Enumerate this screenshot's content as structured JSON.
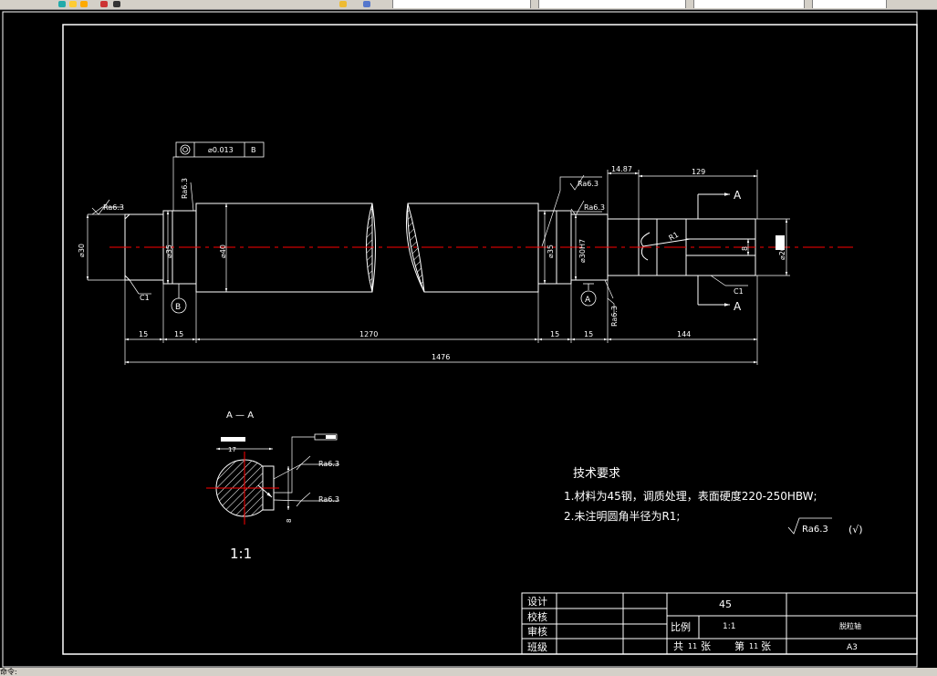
{
  "toolbar": {
    "tab_1": "",
    "tab_2": "",
    "tab_3": "",
    "combo_right": ""
  },
  "dims": {
    "d15a": "15",
    "d15b": "15",
    "d1270": "1270",
    "d15c": "15",
    "d15d": "15",
    "d144": "144",
    "d1476": "1476",
    "d1487": "14.87",
    "d129": "129",
    "dia30": "⌀30",
    "dia35a": "⌀35",
    "dia40": "⌀40",
    "dia35b": "⌀35",
    "dia30h7": "⌀30H7",
    "dia26": "⌀26",
    "d8": "8",
    "r1": "R1"
  },
  "labels": {
    "c1_left": "C1",
    "c1_right": "C1",
    "ra_left": "Ra6.3",
    "ra_top_left": "Ra6.3",
    "ra_top_right": "Ra6.3",
    "ra_mid_right": "Ra6.3",
    "ra_bottom_right": "Ra6.3",
    "datum_b": "B",
    "datum_a": "A",
    "section_a_top": "A",
    "section_a_bottom": "A",
    "gdt_tolerance": "⌀0.013",
    "gdt_datum": "B"
  },
  "section": {
    "title": "A — A",
    "scale": "1:1",
    "ra_top": "Ra6.3",
    "ra_bottom": "Ra6.3",
    "dim_top": "17",
    "dim_side": "8"
  },
  "notes": {
    "heading": "技术要求",
    "line1": "1.材料为45钢，调质处理，表面硬度220-250HBW;",
    "line2": "2.未注明圆角半径为R1;",
    "general_ra": "Ra6.3",
    "general_mark": "(√)"
  },
  "title_block": {
    "design": "设计",
    "check": "校核",
    "review": "审核",
    "class": "班级",
    "material": "45",
    "scale_label": "比例",
    "scale_value": "1:1",
    "part_name": "脱粒轴",
    "total_label": "共",
    "total_value": "11",
    "sheet_unit1": "张",
    "page_label": "第",
    "page_value": "11",
    "sheet_unit2": "张",
    "paper": "A3"
  },
  "statusbar": {
    "text": "命令:"
  },
  "colors": {
    "background": "#000000",
    "lines": "#ffffff",
    "centerline": "#ff0000"
  }
}
